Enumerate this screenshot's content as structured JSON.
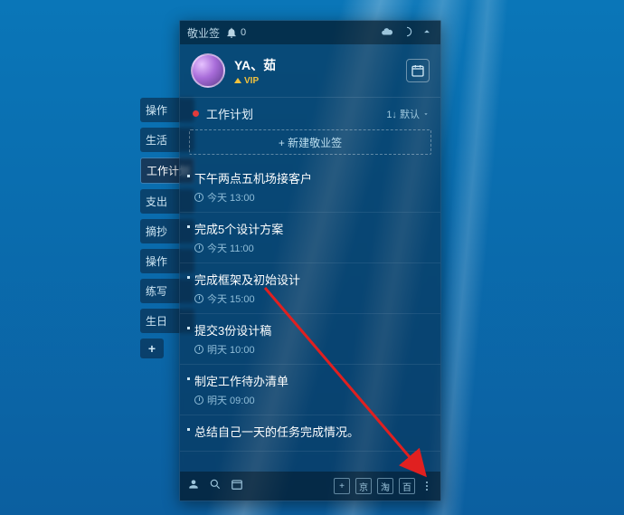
{
  "app": {
    "title": "敬业签",
    "bell_count": "0"
  },
  "profile": {
    "username": "YA、茹",
    "vip_label": "VIP"
  },
  "list": {
    "header": "工作计划",
    "sort_label": "1↓ 默认",
    "new_label": "+ 新建敬业签"
  },
  "items": [
    {
      "title": "下午两点五机场接客户",
      "time": "今天 13:00"
    },
    {
      "title": "完成5个设计方案",
      "time": "今天 11:00"
    },
    {
      "title": "完成框架及初始设计",
      "time": "今天 15:00"
    },
    {
      "title": "提交3份设计稿",
      "time": "明天 10:00"
    },
    {
      "title": "制定工作待办清单",
      "time": "明天 09:00"
    },
    {
      "title": "总结自己一天的任务完成情况。",
      "time": ""
    }
  ],
  "sidetabs": [
    "操作",
    "生活",
    "工作计划",
    "支出",
    "摘抄",
    "操作",
    "练写",
    "生日"
  ],
  "sidetab_add": "+",
  "bottom": {
    "plus": "+",
    "jd": "京",
    "tao": "淘",
    "bai": "百"
  }
}
